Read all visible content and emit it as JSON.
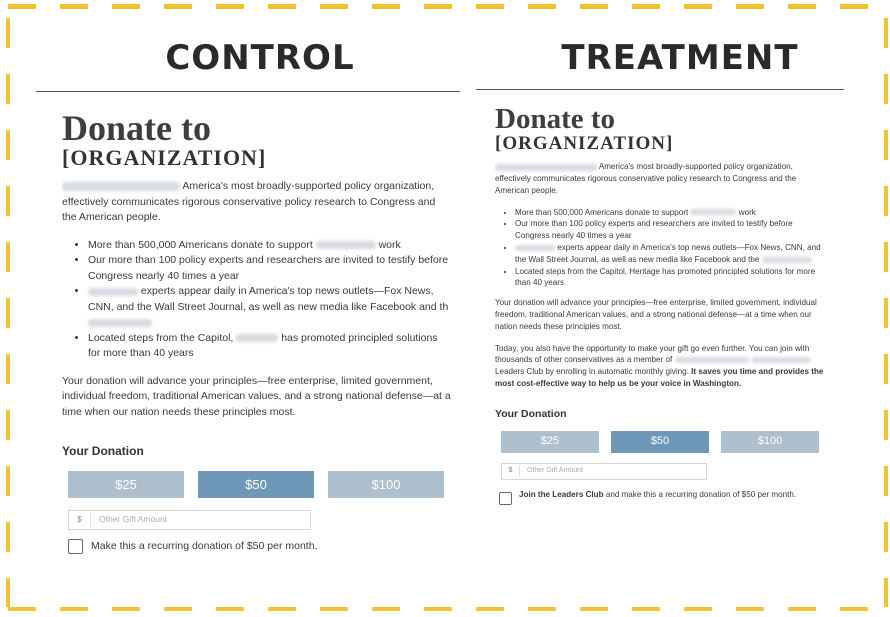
{
  "headings": {
    "control": "CONTROL",
    "treatment": "TREATMENT"
  },
  "control": {
    "title": "Donate to",
    "org": "[ORGANIZATION]",
    "intro": "America's most broadly-supported policy organization, effectively communicates rigorous conservative policy research to Congress and the American people.",
    "bullets": {
      "b1_pre": "More than 500,000 Americans donate to support",
      "b1_post": "work",
      "b2": "Our more than 100 policy experts and researchers are invited to testify before Congress nearly 40 times a year",
      "b3_text": "experts appear daily in America's top news outlets—Fox News, CNN, and the Wall Street Journal, as well as new media like Facebook and th",
      "b4_pre": "Located steps from the Capitol,",
      "b4_post": "has promoted principled solutions for more than 40 years"
    },
    "advance": "Your donation will advance your principles—free enterprise, limited government, individual freedom, traditional American values, and a strong national defense—at a time when our nation needs these principles most.",
    "your_donation": "Your Donation",
    "amounts": [
      "$25",
      "$50",
      "$100"
    ],
    "selected_amount": "$50",
    "currency": "$",
    "other_placeholder": "Other Gift Amount",
    "recurring": "Make this a recurring donation of $50 per month."
  },
  "treatment": {
    "title": "Donate to",
    "org": "[ORGANIZATION]",
    "intro": "America's most broadly-supported policy organization, effectively communicates rigorous conservative policy research to Congress and the American people.",
    "bullets": {
      "b1_pre": "More than 500,000 Americans donate to support",
      "b1_post": "work",
      "b2": "Our more than 100 policy experts and researchers are invited to testify before Congress nearly 40 times a year",
      "b3_text": "experts appear daily in America's top news outlets—Fox News, CNN, and the Wall Street Journal, as well as new media like Facebook and the",
      "b4": "Located steps from the Capitol, Heritage has promoted principled solutions for more than 40 years"
    },
    "advance": "Your donation will advance your principles—free enterprise, limited government, individual freedom, traditional American values, and a strong national defense—at a time when our nation needs these principles most.",
    "today_1": "Today, you also have the opportunity to make your gift go even further. You can join with thousands of other conservatives as a member of",
    "today_2": "Leaders Club by enrolling in automatic monthly giving.",
    "today_bold": "It saves you time and provides the most cost-effective way to help us be your voice in Washington.",
    "your_donation": "Your Donation",
    "amounts": [
      "$25",
      "$50",
      "$100"
    ],
    "selected_amount": "$50",
    "currency": "$",
    "other_placeholder": "Other Gift Amount",
    "recurring_bold": "Join the Leaders Club",
    "recurring_rest": "and make this a recurring donation of $50 per month."
  },
  "colors": {
    "dash": "#f2c233",
    "selected": "#6f97b7",
    "unselected": "#aebfcd"
  }
}
